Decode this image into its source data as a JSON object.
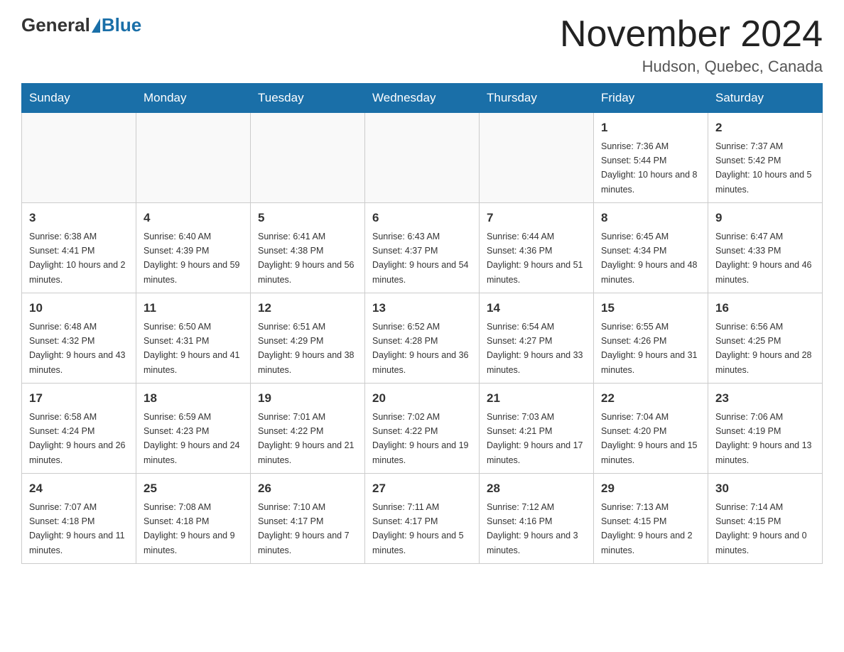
{
  "header": {
    "logo_general": "General",
    "logo_blue": "Blue",
    "month_title": "November 2024",
    "location": "Hudson, Quebec, Canada"
  },
  "days_of_week": [
    "Sunday",
    "Monday",
    "Tuesday",
    "Wednesday",
    "Thursday",
    "Friday",
    "Saturday"
  ],
  "weeks": [
    [
      {
        "day": "",
        "info": ""
      },
      {
        "day": "",
        "info": ""
      },
      {
        "day": "",
        "info": ""
      },
      {
        "day": "",
        "info": ""
      },
      {
        "day": "",
        "info": ""
      },
      {
        "day": "1",
        "info": "Sunrise: 7:36 AM\nSunset: 5:44 PM\nDaylight: 10 hours and 8 minutes."
      },
      {
        "day": "2",
        "info": "Sunrise: 7:37 AM\nSunset: 5:42 PM\nDaylight: 10 hours and 5 minutes."
      }
    ],
    [
      {
        "day": "3",
        "info": "Sunrise: 6:38 AM\nSunset: 4:41 PM\nDaylight: 10 hours and 2 minutes."
      },
      {
        "day": "4",
        "info": "Sunrise: 6:40 AM\nSunset: 4:39 PM\nDaylight: 9 hours and 59 minutes."
      },
      {
        "day": "5",
        "info": "Sunrise: 6:41 AM\nSunset: 4:38 PM\nDaylight: 9 hours and 56 minutes."
      },
      {
        "day": "6",
        "info": "Sunrise: 6:43 AM\nSunset: 4:37 PM\nDaylight: 9 hours and 54 minutes."
      },
      {
        "day": "7",
        "info": "Sunrise: 6:44 AM\nSunset: 4:36 PM\nDaylight: 9 hours and 51 minutes."
      },
      {
        "day": "8",
        "info": "Sunrise: 6:45 AM\nSunset: 4:34 PM\nDaylight: 9 hours and 48 minutes."
      },
      {
        "day": "9",
        "info": "Sunrise: 6:47 AM\nSunset: 4:33 PM\nDaylight: 9 hours and 46 minutes."
      }
    ],
    [
      {
        "day": "10",
        "info": "Sunrise: 6:48 AM\nSunset: 4:32 PM\nDaylight: 9 hours and 43 minutes."
      },
      {
        "day": "11",
        "info": "Sunrise: 6:50 AM\nSunset: 4:31 PM\nDaylight: 9 hours and 41 minutes."
      },
      {
        "day": "12",
        "info": "Sunrise: 6:51 AM\nSunset: 4:29 PM\nDaylight: 9 hours and 38 minutes."
      },
      {
        "day": "13",
        "info": "Sunrise: 6:52 AM\nSunset: 4:28 PM\nDaylight: 9 hours and 36 minutes."
      },
      {
        "day": "14",
        "info": "Sunrise: 6:54 AM\nSunset: 4:27 PM\nDaylight: 9 hours and 33 minutes."
      },
      {
        "day": "15",
        "info": "Sunrise: 6:55 AM\nSunset: 4:26 PM\nDaylight: 9 hours and 31 minutes."
      },
      {
        "day": "16",
        "info": "Sunrise: 6:56 AM\nSunset: 4:25 PM\nDaylight: 9 hours and 28 minutes."
      }
    ],
    [
      {
        "day": "17",
        "info": "Sunrise: 6:58 AM\nSunset: 4:24 PM\nDaylight: 9 hours and 26 minutes."
      },
      {
        "day": "18",
        "info": "Sunrise: 6:59 AM\nSunset: 4:23 PM\nDaylight: 9 hours and 24 minutes."
      },
      {
        "day": "19",
        "info": "Sunrise: 7:01 AM\nSunset: 4:22 PM\nDaylight: 9 hours and 21 minutes."
      },
      {
        "day": "20",
        "info": "Sunrise: 7:02 AM\nSunset: 4:22 PM\nDaylight: 9 hours and 19 minutes."
      },
      {
        "day": "21",
        "info": "Sunrise: 7:03 AM\nSunset: 4:21 PM\nDaylight: 9 hours and 17 minutes."
      },
      {
        "day": "22",
        "info": "Sunrise: 7:04 AM\nSunset: 4:20 PM\nDaylight: 9 hours and 15 minutes."
      },
      {
        "day": "23",
        "info": "Sunrise: 7:06 AM\nSunset: 4:19 PM\nDaylight: 9 hours and 13 minutes."
      }
    ],
    [
      {
        "day": "24",
        "info": "Sunrise: 7:07 AM\nSunset: 4:18 PM\nDaylight: 9 hours and 11 minutes."
      },
      {
        "day": "25",
        "info": "Sunrise: 7:08 AM\nSunset: 4:18 PM\nDaylight: 9 hours and 9 minutes."
      },
      {
        "day": "26",
        "info": "Sunrise: 7:10 AM\nSunset: 4:17 PM\nDaylight: 9 hours and 7 minutes."
      },
      {
        "day": "27",
        "info": "Sunrise: 7:11 AM\nSunset: 4:17 PM\nDaylight: 9 hours and 5 minutes."
      },
      {
        "day": "28",
        "info": "Sunrise: 7:12 AM\nSunset: 4:16 PM\nDaylight: 9 hours and 3 minutes."
      },
      {
        "day": "29",
        "info": "Sunrise: 7:13 AM\nSunset: 4:15 PM\nDaylight: 9 hours and 2 minutes."
      },
      {
        "day": "30",
        "info": "Sunrise: 7:14 AM\nSunset: 4:15 PM\nDaylight: 9 hours and 0 minutes."
      }
    ]
  ]
}
